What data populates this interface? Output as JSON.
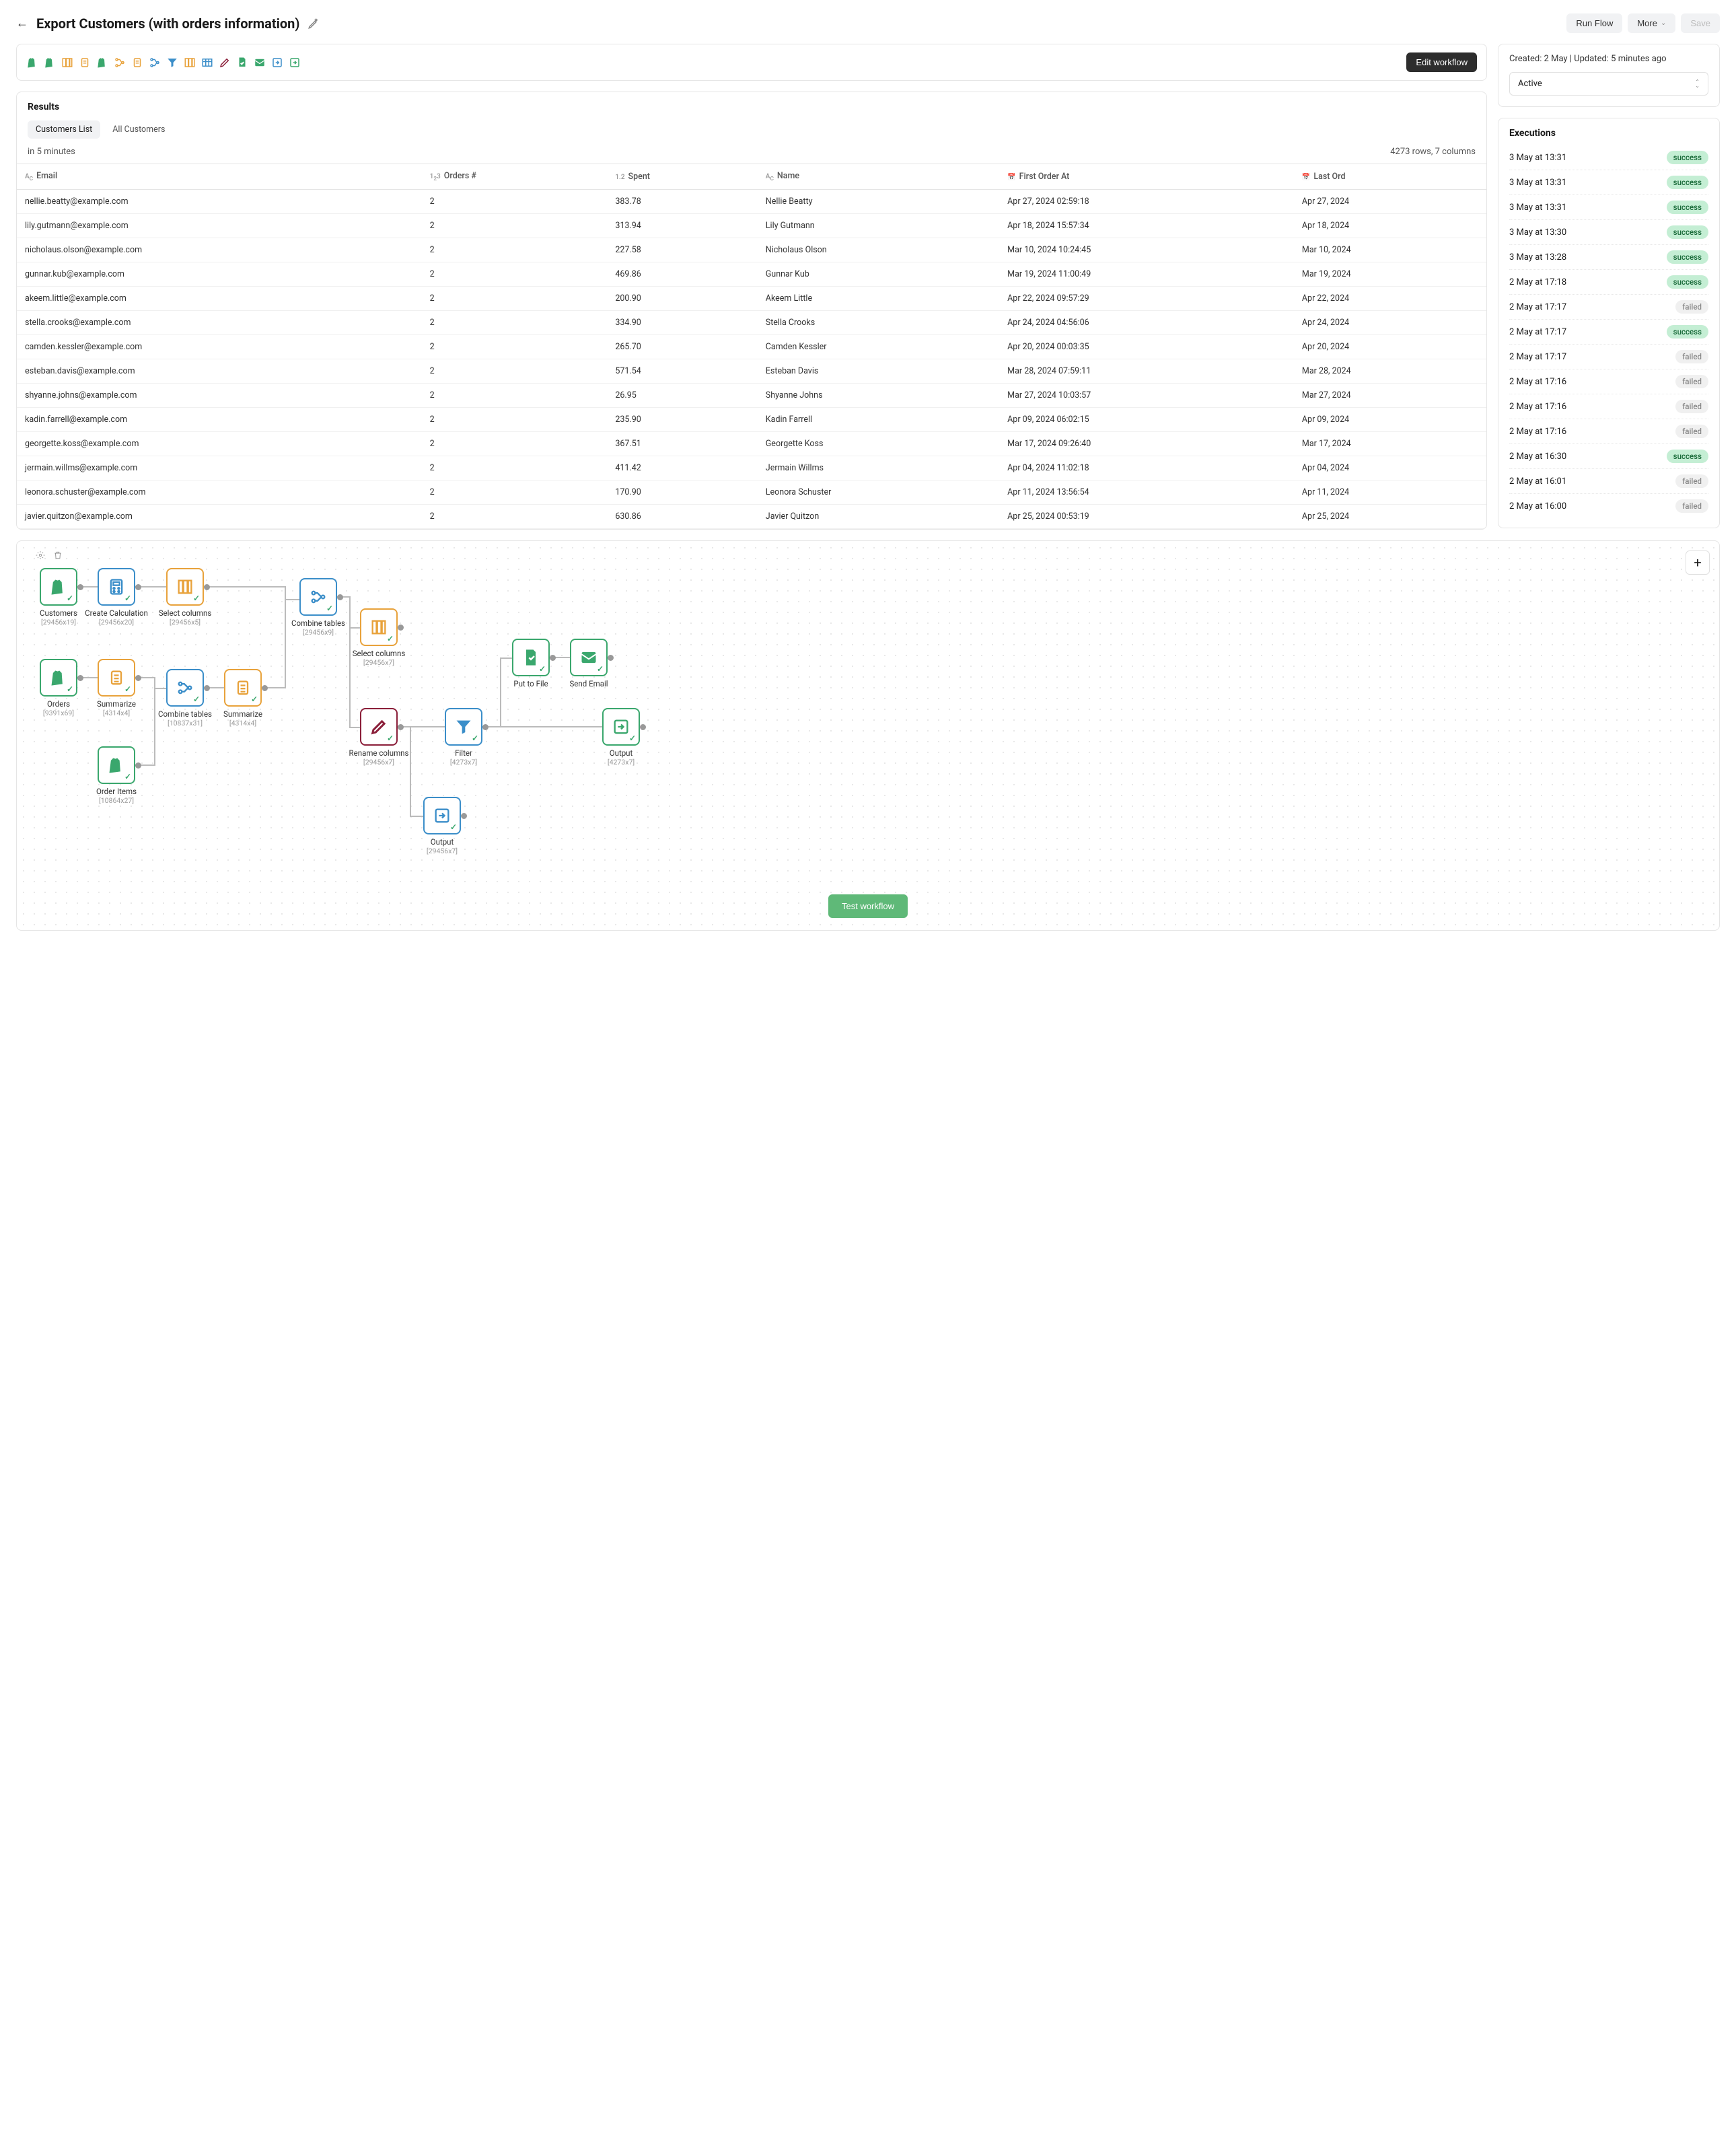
{
  "header": {
    "title": "Export Customers (with orders information)",
    "run_flow": "Run Flow",
    "more": "More",
    "save": "Save"
  },
  "toolbar": {
    "edit_workflow": "Edit workflow"
  },
  "meta": {
    "text": "Created: 2 May | Updated: 5 minutes ago",
    "status": "Active"
  },
  "results": {
    "title": "Results",
    "tab_customers": "Customers List",
    "tab_all": "All Customers",
    "schedule": "in 5 minutes",
    "summary": "4273 rows, 7 columns",
    "cols": {
      "email": "Email",
      "orders": "Orders #",
      "spent": "Spent",
      "name": "Name",
      "first": "First Order At",
      "last": "Last Ord"
    },
    "rows": [
      {
        "email": "nellie.beatty@example.com",
        "orders": "2",
        "spent": "383.78",
        "name": "Nellie Beatty",
        "first": "Apr 27, 2024 02:59:18",
        "last": "Apr 27, 2024"
      },
      {
        "email": "lily.gutmann@example.com",
        "orders": "2",
        "spent": "313.94",
        "name": "Lily Gutmann",
        "first": "Apr 18, 2024 15:57:34",
        "last": "Apr 18, 2024"
      },
      {
        "email": "nicholaus.olson@example.com",
        "orders": "2",
        "spent": "227.58",
        "name": "Nicholaus Olson",
        "first": "Mar 10, 2024 10:24:45",
        "last": "Mar 10, 2024"
      },
      {
        "email": "gunnar.kub@example.com",
        "orders": "2",
        "spent": "469.86",
        "name": "Gunnar Kub",
        "first": "Mar 19, 2024 11:00:49",
        "last": "Mar 19, 2024"
      },
      {
        "email": "akeem.little@example.com",
        "orders": "2",
        "spent": "200.90",
        "name": "Akeem Little",
        "first": "Apr 22, 2024 09:57:29",
        "last": "Apr 22, 2024"
      },
      {
        "email": "stella.crooks@example.com",
        "orders": "2",
        "spent": "334.90",
        "name": "Stella Crooks",
        "first": "Apr 24, 2024 04:56:06",
        "last": "Apr 24, 2024"
      },
      {
        "email": "camden.kessler@example.com",
        "orders": "2",
        "spent": "265.70",
        "name": "Camden Kessler",
        "first": "Apr 20, 2024 00:03:35",
        "last": "Apr 20, 2024"
      },
      {
        "email": "esteban.davis@example.com",
        "orders": "2",
        "spent": "571.54",
        "name": "Esteban Davis",
        "first": "Mar 28, 2024 07:59:11",
        "last": "Mar 28, 2024"
      },
      {
        "email": "shyanne.johns@example.com",
        "orders": "2",
        "spent": "26.95",
        "name": "Shyanne Johns",
        "first": "Mar 27, 2024 10:03:57",
        "last": "Mar 27, 2024"
      },
      {
        "email": "kadin.farrell@example.com",
        "orders": "2",
        "spent": "235.90",
        "name": "Kadin Farrell",
        "first": "Apr 09, 2024 06:02:15",
        "last": "Apr 09, 2024"
      },
      {
        "email": "georgette.koss@example.com",
        "orders": "2",
        "spent": "367.51",
        "name": "Georgette Koss",
        "first": "Mar 17, 2024 09:26:40",
        "last": "Mar 17, 2024"
      },
      {
        "email": "jermain.willms@example.com",
        "orders": "2",
        "spent": "411.42",
        "name": "Jermain Willms",
        "first": "Apr 04, 2024 11:02:18",
        "last": "Apr 04, 2024"
      },
      {
        "email": "leonora.schuster@example.com",
        "orders": "2",
        "spent": "170.90",
        "name": "Leonora Schuster",
        "first": "Apr 11, 2024 13:56:54",
        "last": "Apr 11, 2024"
      },
      {
        "email": "javier.quitzon@example.com",
        "orders": "2",
        "spent": "630.86",
        "name": "Javier Quitzon",
        "first": "Apr 25, 2024 00:53:19",
        "last": "Apr 25, 2024"
      }
    ]
  },
  "executions": {
    "title": "Executions",
    "items": [
      {
        "time": "3 May at 13:31",
        "status": "success"
      },
      {
        "time": "3 May at 13:31",
        "status": "success"
      },
      {
        "time": "3 May at 13:31",
        "status": "success"
      },
      {
        "time": "3 May at 13:30",
        "status": "success"
      },
      {
        "time": "3 May at 13:28",
        "status": "success"
      },
      {
        "time": "2 May at 17:18",
        "status": "success"
      },
      {
        "time": "2 May at 17:17",
        "status": "failed"
      },
      {
        "time": "2 May at 17:17",
        "status": "success"
      },
      {
        "time": "2 May at 17:17",
        "status": "failed"
      },
      {
        "time": "2 May at 17:16",
        "status": "failed"
      },
      {
        "time": "2 May at 17:16",
        "status": "failed"
      },
      {
        "time": "2 May at 17:16",
        "status": "failed"
      },
      {
        "time": "2 May at 16:30",
        "status": "success"
      },
      {
        "time": "2 May at 16:01",
        "status": "failed"
      },
      {
        "time": "2 May at 16:00",
        "status": "failed"
      }
    ]
  },
  "canvas": {
    "test_workflow": "Test workflow",
    "nodes": {
      "customers": {
        "label": "Customers",
        "dim": "[29456x19]"
      },
      "create_calc": {
        "label": "Create Calculation",
        "dim": "[29456x20]"
      },
      "select1": {
        "label": "Select columns",
        "dim": "[29456x5]"
      },
      "combine1": {
        "label": "Combine tables",
        "dim": "[29456x9]"
      },
      "select2": {
        "label": "Select columns",
        "dim": "[29456x7]"
      },
      "orders": {
        "label": "Orders",
        "dim": "[9391x69]"
      },
      "summarize1": {
        "label": "Summarize",
        "dim": "[4314x4]"
      },
      "combine2": {
        "label": "Combine tables",
        "dim": "[10837x31]"
      },
      "summarize2": {
        "label": "Summarize",
        "dim": "[4314x4]"
      },
      "order_items": {
        "label": "Order Items",
        "dim": "[10864x27]"
      },
      "rename": {
        "label": "Rename columns",
        "dim": "[29456x7]"
      },
      "filter": {
        "label": "Filter",
        "dim": "[4273x7]"
      },
      "put_file": {
        "label": "Put to File",
        "dim": ""
      },
      "send_email": {
        "label": "Send Email",
        "dim": ""
      },
      "output1": {
        "label": "Output",
        "dim": "[4273x7]"
      },
      "output2": {
        "label": "Output",
        "dim": "[29456x7]"
      }
    }
  }
}
